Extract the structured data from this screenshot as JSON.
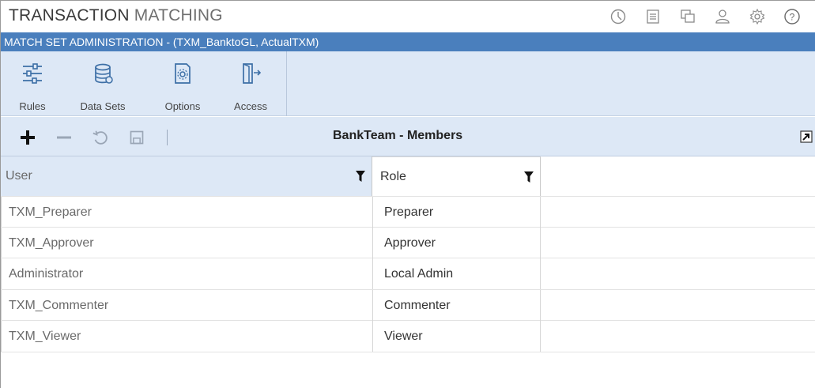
{
  "app": {
    "title_part1": "TRANSACTION",
    "title_part2": "MATCHING"
  },
  "top_icons": [
    "clock-icon",
    "document-icon",
    "windows-icon",
    "user-icon",
    "settings-icon",
    "help-icon"
  ],
  "header": {
    "title": "MATCH SET ADMINISTRATION - (TXM_BanktoGL, ActualTXM)"
  },
  "ribbon": {
    "rules": "Rules",
    "data_sets": "Data Sets",
    "options": "Options",
    "access": "Access"
  },
  "toolbar": {
    "title": "BankTeam - Members"
  },
  "grid": {
    "columns": {
      "user": "User",
      "role": "Role"
    },
    "rows": [
      {
        "user": "TXM_Preparer",
        "role": "Preparer"
      },
      {
        "user": "TXM_Approver",
        "role": "Approver"
      },
      {
        "user": "Administrator",
        "role": "Local Admin"
      },
      {
        "user": "TXM_Commenter",
        "role": "Commenter"
      },
      {
        "user": "TXM_Viewer",
        "role": "Viewer"
      }
    ]
  },
  "colors": {
    "header_blue": "#4a7fbd",
    "ribbon_bg": "#dde8f6"
  }
}
